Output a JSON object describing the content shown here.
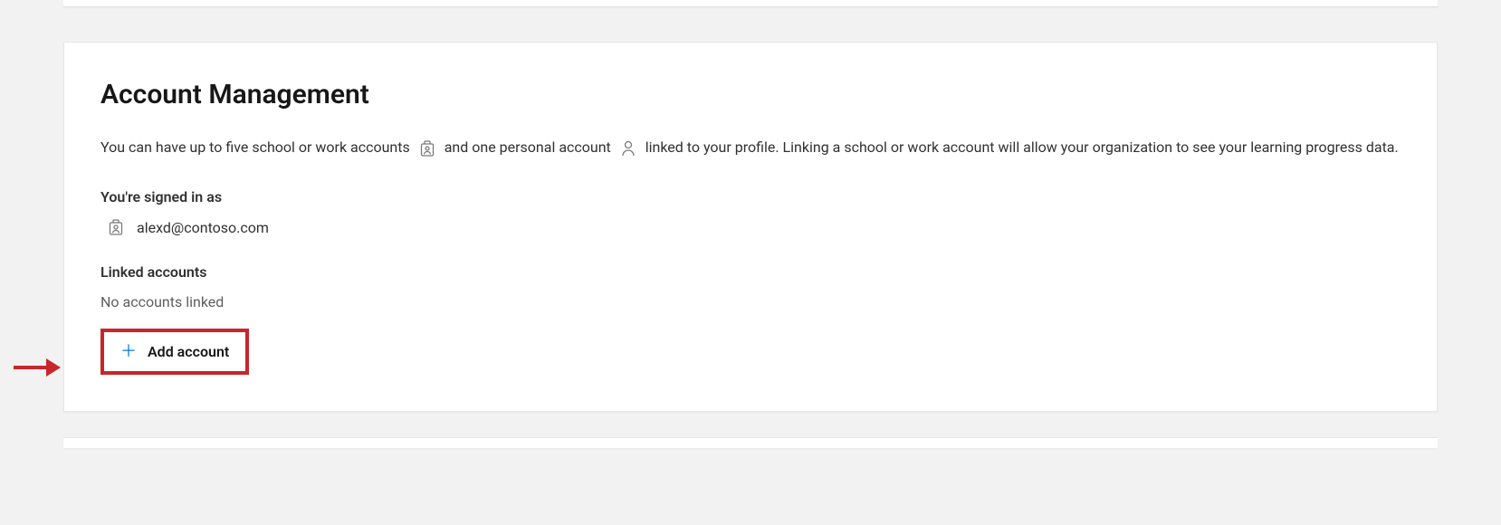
{
  "section": {
    "title": "Account Management",
    "description_part1": "You can have up to five school or work accounts",
    "description_part2": "and one personal account",
    "description_part3": "linked to your profile. Linking a school or work account will allow your organization to see your learning progress data.",
    "signed_in_heading": "You're signed in as",
    "signed_in_email": "alexd@contoso.com",
    "linked_heading": "Linked accounts",
    "no_linked": "No accounts linked",
    "add_account_label": "Add account"
  }
}
